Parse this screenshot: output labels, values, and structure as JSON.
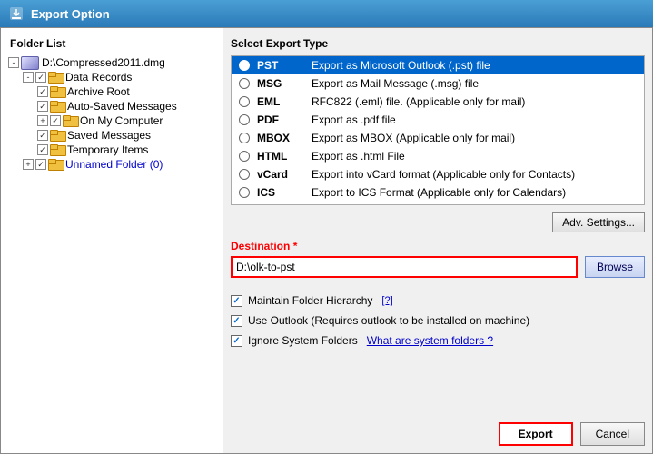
{
  "titleBar": {
    "icon": "export-icon",
    "title": "Export Option"
  },
  "leftPanel": {
    "header": "Folder List",
    "tree": [
      {
        "id": "dmg-root",
        "label": "D:\\Compressed2011.dmg",
        "indent": 1,
        "expander": "-",
        "hasCheck": false,
        "type": "dmg"
      },
      {
        "id": "data-records",
        "label": "Data Records",
        "indent": 2,
        "expander": "-",
        "hasCheck": true,
        "checked": true,
        "type": "folder"
      },
      {
        "id": "archive-root",
        "label": "Archive Root",
        "indent": 3,
        "expander": null,
        "hasCheck": true,
        "checked": true,
        "type": "folder"
      },
      {
        "id": "auto-saved",
        "label": "Auto-Saved Messages",
        "indent": 3,
        "expander": null,
        "hasCheck": true,
        "checked": true,
        "type": "folder"
      },
      {
        "id": "on-my-computer",
        "label": "On My Computer",
        "indent": 3,
        "expander": "+",
        "hasCheck": true,
        "checked": true,
        "type": "folder"
      },
      {
        "id": "saved-messages",
        "label": "Saved Messages",
        "indent": 3,
        "expander": null,
        "hasCheck": true,
        "checked": true,
        "type": "folder"
      },
      {
        "id": "temporary-items",
        "label": "Temporary Items",
        "indent": 3,
        "expander": null,
        "hasCheck": true,
        "checked": true,
        "type": "folder"
      },
      {
        "id": "unnamed-folder",
        "label": "Unnamed Folder (0)",
        "indent": 2,
        "expander": "+",
        "hasCheck": true,
        "checked": true,
        "type": "folder",
        "labelClass": "blue"
      }
    ]
  },
  "rightPanel": {
    "header": "Select Export Type",
    "exportTypes": [
      {
        "id": "pst",
        "name": "PST",
        "description": "Export as Microsoft Outlook (.pst) file",
        "selected": true
      },
      {
        "id": "msg",
        "name": "MSG",
        "description": "Export as Mail Message (.msg) file",
        "selected": false
      },
      {
        "id": "eml",
        "name": "EML",
        "description": "RFC822 (.eml) file. (Applicable only for mail)",
        "selected": false
      },
      {
        "id": "pdf",
        "name": "PDF",
        "description": "Export as .pdf file",
        "selected": false
      },
      {
        "id": "mbox",
        "name": "MBOX",
        "description": "Export as MBOX (Applicable only for mail)",
        "selected": false
      },
      {
        "id": "html",
        "name": "HTML",
        "description": "Export as .html File",
        "selected": false
      },
      {
        "id": "vcard",
        "name": "vCard",
        "description": "Export into vCard format (Applicable only for Contacts)",
        "selected": false
      },
      {
        "id": "ics",
        "name": "ICS",
        "description": "Export to ICS Format (Applicable only for Calendars)",
        "selected": false
      }
    ],
    "advButton": "Adv. Settings...",
    "destination": {
      "label": "Destination",
      "required": true,
      "value": "D:\\olk-to-pst",
      "placeholder": "",
      "browseLabel": "Browse"
    },
    "options": [
      {
        "id": "maintain-hierarchy",
        "label": "Maintain Folder Hierarchy",
        "checked": true,
        "helpLink": "[?]"
      },
      {
        "id": "use-outlook",
        "label": "Use Outlook (Requires outlook to be installed on machine)",
        "checked": true,
        "helpLink": null
      },
      {
        "id": "ignore-system",
        "label": "Ignore System Folders",
        "checked": true,
        "helpLink": "What are system folders ?"
      }
    ],
    "exportButton": "Export",
    "cancelButton": "Cancel"
  }
}
